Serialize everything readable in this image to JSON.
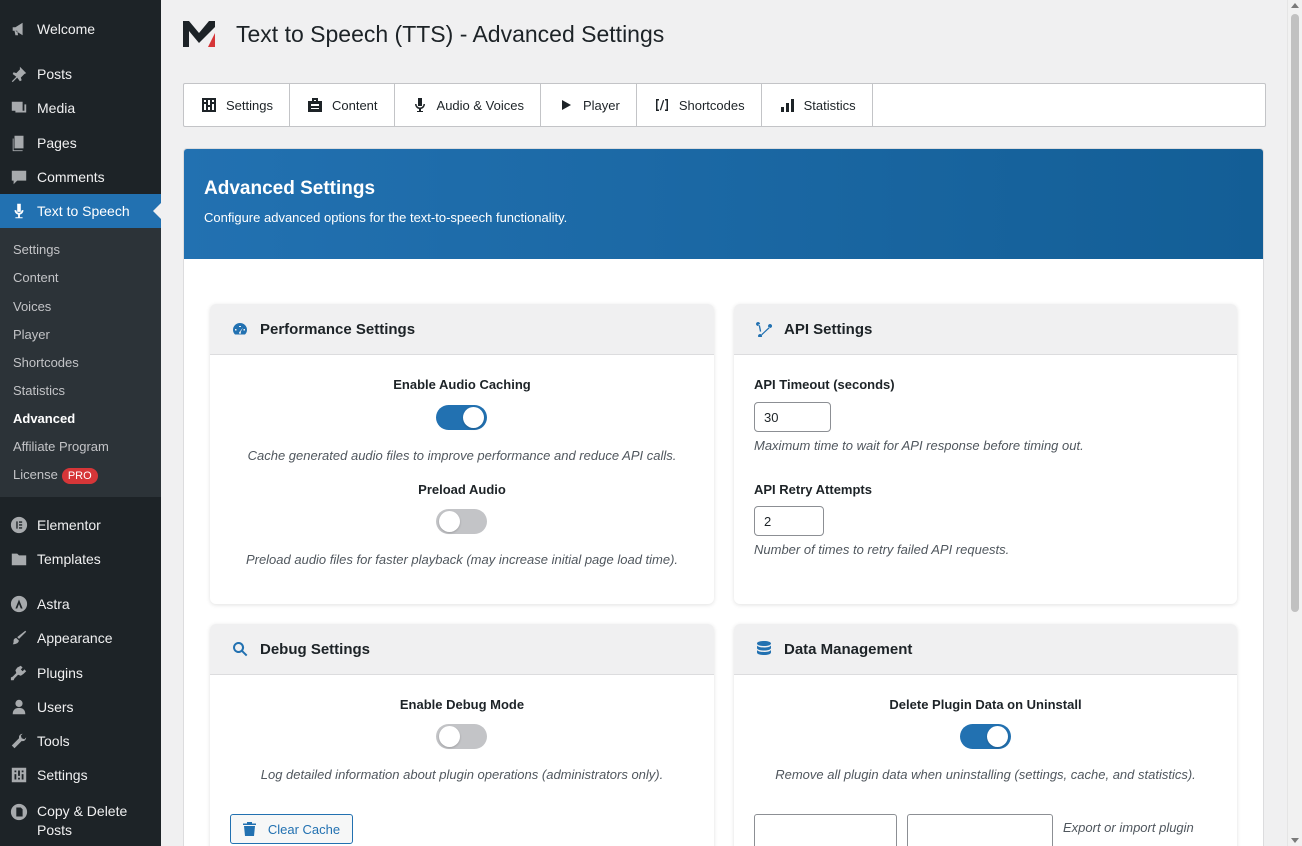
{
  "sidebar": {
    "top_items": [
      {
        "label": "Welcome"
      },
      {
        "label": "Posts"
      },
      {
        "label": "Media"
      },
      {
        "label": "Pages"
      },
      {
        "label": "Comments"
      },
      {
        "label": "Text to Speech"
      }
    ],
    "submenu": [
      {
        "label": "Settings"
      },
      {
        "label": "Content"
      },
      {
        "label": "Voices"
      },
      {
        "label": "Player"
      },
      {
        "label": "Shortcodes"
      },
      {
        "label": "Statistics"
      },
      {
        "label": "Advanced"
      },
      {
        "label": "Affiliate Program"
      },
      {
        "label": "License",
        "badge": "PRO"
      }
    ],
    "bottom_items": [
      {
        "label": "Elementor"
      },
      {
        "label": "Templates"
      },
      {
        "label": "Astra"
      },
      {
        "label": "Appearance"
      },
      {
        "label": "Plugins"
      },
      {
        "label": "Users"
      },
      {
        "label": "Tools"
      },
      {
        "label": "Settings"
      },
      {
        "label_line1": "Copy & Delete",
        "label_line2": "Posts"
      }
    ]
  },
  "header": {
    "title": "Text to Speech (TTS) - Advanced Settings"
  },
  "tabs": [
    {
      "label": "Settings"
    },
    {
      "label": "Content"
    },
    {
      "label": "Audio & Voices"
    },
    {
      "label": "Player"
    },
    {
      "label": "Shortcodes"
    },
    {
      "label": "Statistics"
    }
  ],
  "hero": {
    "title": "Advanced Settings",
    "subtitle": "Configure advanced options for the text-to-speech functionality."
  },
  "performance": {
    "title": "Performance Settings",
    "audio_caching": {
      "label": "Enable Audio Caching",
      "enabled": true,
      "desc": "Cache generated audio files to improve performance and reduce API calls."
    },
    "preload_audio": {
      "label": "Preload Audio",
      "enabled": false,
      "desc": "Preload audio files for faster playback (may increase initial page load time)."
    }
  },
  "api": {
    "title": "API Settings",
    "timeout": {
      "label": "API Timeout (seconds)",
      "value": "30",
      "desc": "Maximum time to wait for API response before timing out."
    },
    "retry": {
      "label": "API Retry Attempts",
      "value": "2",
      "desc": "Number of times to retry failed API requests."
    }
  },
  "debug": {
    "title": "Debug Settings",
    "debug_mode": {
      "label": "Enable Debug Mode",
      "enabled": false,
      "desc": "Log detailed information about plugin operations (administrators only)."
    },
    "clear_cache_label": "Clear Cache"
  },
  "data_mgmt": {
    "title": "Data Management",
    "delete_on_uninstall": {
      "label": "Delete Plugin Data on Uninstall",
      "enabled": true,
      "desc": "Remove all plugin data when uninstalling (settings, cache, and statistics)."
    },
    "export_import_desc": "Export or import plugin"
  },
  "colors": {
    "accent": "#2271b1",
    "sidebar_bg": "#1d2327",
    "badge": "#d63638"
  }
}
